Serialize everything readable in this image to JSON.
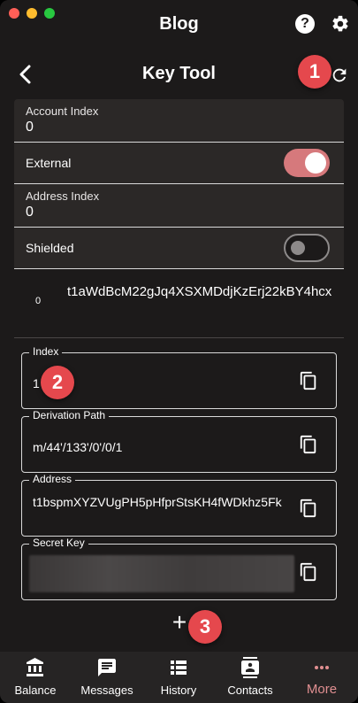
{
  "window": {
    "title": "Blog"
  },
  "header": {
    "title": "Key Tool"
  },
  "settings": {
    "account_index_label": "Account Index",
    "account_index_value": "0",
    "external_label": "External",
    "external_on": true,
    "address_index_label": "Address Index",
    "address_index_value": "0",
    "shielded_label": "Shielded",
    "shielded_on": false
  },
  "address_row": {
    "index": "0",
    "address": "t1aWdBcM22gJq4XSXMDdjKzErj22kBY4hcx"
  },
  "fields": [
    {
      "label": "Index",
      "value": "1"
    },
    {
      "label": "Derivation Path",
      "value": "m/44'/133'/0'/0/1"
    },
    {
      "label": "Address",
      "value": "t1bspmXYZVUgPH5pHfprStsKH4fWDkhz5Fk"
    },
    {
      "label": "Secret Key",
      "value": ""
    }
  ],
  "add_button_label": "+",
  "badges": [
    "1",
    "2",
    "3"
  ],
  "nav": [
    {
      "label": "Balance",
      "icon": "bank-icon"
    },
    {
      "label": "Messages",
      "icon": "message-icon"
    },
    {
      "label": "History",
      "icon": "list-icon"
    },
    {
      "label": "Contacts",
      "icon": "contacts-icon"
    },
    {
      "label": "More",
      "icon": "more-icon",
      "active": true
    }
  ],
  "colors": {
    "background": "#1c1a1a",
    "card": "#2b2827",
    "accent": "#d6797c",
    "badge": "#e5484d",
    "nav_active": "#e08f91"
  }
}
